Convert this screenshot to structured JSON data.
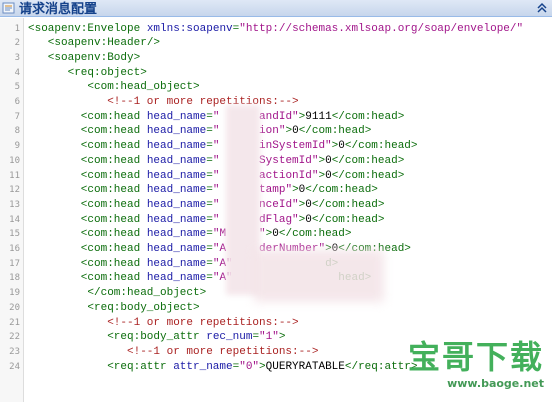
{
  "header": {
    "title": "请求消息配置"
  },
  "lines": [
    {
      "n": "1",
      "indent": 0,
      "parts": [
        [
          "tag",
          "<soapenv:Envelope "
        ],
        [
          "attr",
          "xmlns:soapenv"
        ],
        [
          "tag",
          "="
        ],
        [
          "val",
          "\"http://schemas.xmlsoap.org/soap/envelope/\""
        ]
      ]
    },
    {
      "n": "2",
      "indent": 3,
      "parts": [
        [
          "tag",
          "<soapenv:Header/>"
        ]
      ]
    },
    {
      "n": "3",
      "indent": 3,
      "parts": [
        [
          "tag",
          "<soapenv:Body>"
        ]
      ]
    },
    {
      "n": "4",
      "indent": 6,
      "parts": [
        [
          "tag",
          "<req:object>"
        ]
      ]
    },
    {
      "n": "5",
      "indent": 9,
      "parts": [
        [
          "tag",
          "<com:head_object>"
        ]
      ]
    },
    {
      "n": "6",
      "indent": 12,
      "parts": [
        [
          "com",
          "<!--1 or more repetitions:-->"
        ]
      ]
    },
    {
      "n": "7",
      "indent": 8,
      "parts": [
        [
          "tag",
          "<com:head "
        ],
        [
          "attr",
          "head_name"
        ],
        [
          "tag",
          "="
        ],
        [
          "val",
          "\"      andId\""
        ],
        [
          "tag",
          ">"
        ],
        [
          "text",
          "9111"
        ],
        [
          "tag",
          "</com:head>"
        ]
      ]
    },
    {
      "n": "8",
      "indent": 8,
      "parts": [
        [
          "tag",
          "<com:head "
        ],
        [
          "attr",
          "head_name"
        ],
        [
          "tag",
          "="
        ],
        [
          "val",
          "\"      ion\""
        ],
        [
          "tag",
          ">"
        ],
        [
          "text",
          "0"
        ],
        [
          "tag",
          "</com:head>"
        ]
      ]
    },
    {
      "n": "9",
      "indent": 8,
      "parts": [
        [
          "tag",
          "<com:head "
        ],
        [
          "attr",
          "head_name"
        ],
        [
          "tag",
          "="
        ],
        [
          "val",
          "\"      inSystemId\""
        ],
        [
          "tag",
          ">"
        ],
        [
          "text",
          "0"
        ],
        [
          "tag",
          "</com:head>"
        ]
      ]
    },
    {
      "n": "10",
      "indent": 8,
      "parts": [
        [
          "tag",
          "<com:head "
        ],
        [
          "attr",
          "head_name"
        ],
        [
          "tag",
          "="
        ],
        [
          "val",
          "\"      SystemId\""
        ],
        [
          "tag",
          ">"
        ],
        [
          "text",
          "0"
        ],
        [
          "tag",
          "</com:head>"
        ]
      ]
    },
    {
      "n": "11",
      "indent": 8,
      "parts": [
        [
          "tag",
          "<com:head "
        ],
        [
          "attr",
          "head_name"
        ],
        [
          "tag",
          "="
        ],
        [
          "val",
          "\"      actionId\""
        ],
        [
          "tag",
          ">"
        ],
        [
          "text",
          "0"
        ],
        [
          "tag",
          "</com:head>"
        ]
      ]
    },
    {
      "n": "12",
      "indent": 8,
      "parts": [
        [
          "tag",
          "<com:head "
        ],
        [
          "attr",
          "head_name"
        ],
        [
          "tag",
          "="
        ],
        [
          "val",
          "\"      tamp\""
        ],
        [
          "tag",
          ">"
        ],
        [
          "text",
          "0"
        ],
        [
          "tag",
          "</com:head>"
        ]
      ]
    },
    {
      "n": "13",
      "indent": 8,
      "parts": [
        [
          "tag",
          "<com:head "
        ],
        [
          "attr",
          "head_name"
        ],
        [
          "tag",
          "="
        ],
        [
          "val",
          "\"      nceId\""
        ],
        [
          "tag",
          ">"
        ],
        [
          "text",
          "0"
        ],
        [
          "tag",
          "</com:head>"
        ]
      ]
    },
    {
      "n": "14",
      "indent": 8,
      "parts": [
        [
          "tag",
          "<com:head "
        ],
        [
          "attr",
          "head_name"
        ],
        [
          "tag",
          "="
        ],
        [
          "val",
          "\"      dFlag\""
        ],
        [
          "tag",
          ">"
        ],
        [
          "text",
          "0"
        ],
        [
          "tag",
          "</com:head>"
        ]
      ]
    },
    {
      "n": "15",
      "indent": 8,
      "parts": [
        [
          "tag",
          "<com:head "
        ],
        [
          "attr",
          "head_name"
        ],
        [
          "tag",
          "="
        ],
        [
          "val",
          "\"M     \""
        ],
        [
          "tag",
          ">"
        ],
        [
          "text",
          "0"
        ],
        [
          "tag",
          "</com:head>"
        ]
      ]
    },
    {
      "n": "16",
      "indent": 8,
      "parts": [
        [
          "tag",
          "<com:head "
        ],
        [
          "attr",
          "head_name"
        ],
        [
          "tag",
          "="
        ],
        [
          "val",
          "\"A     derNumber\""
        ],
        [
          "tag",
          ">"
        ],
        [
          "text",
          "0"
        ],
        [
          "tag",
          "</com:head>"
        ]
      ]
    },
    {
      "n": "17",
      "indent": 8,
      "parts": [
        [
          "tag",
          "<com:head "
        ],
        [
          "attr",
          "head_name"
        ],
        [
          "tag",
          "="
        ],
        [
          "val",
          "\"A\""
        ],
        [
          "tag",
          "              d>"
        ]
      ]
    },
    {
      "n": "18",
      "indent": 8,
      "parts": [
        [
          "tag",
          "<com:head "
        ],
        [
          "attr",
          "head_name"
        ],
        [
          "tag",
          "="
        ],
        [
          "val",
          "\"A\""
        ],
        [
          "tag",
          "                head>"
        ]
      ]
    },
    {
      "n": "19",
      "indent": 9,
      "parts": [
        [
          "tag",
          "</com:head_object>"
        ]
      ]
    },
    {
      "n": "20",
      "indent": 9,
      "parts": [
        [
          "tag",
          "<req:body_object>"
        ]
      ]
    },
    {
      "n": "21",
      "indent": 12,
      "parts": [
        [
          "com",
          "<!--1 or more repetitions:-->"
        ]
      ]
    },
    {
      "n": "22",
      "indent": 12,
      "parts": [
        [
          "tag",
          "<req:body_attr "
        ],
        [
          "attr",
          "rec_num"
        ],
        [
          "tag",
          "="
        ],
        [
          "val",
          "\"1\""
        ],
        [
          "tag",
          ">"
        ]
      ]
    },
    {
      "n": "23",
      "indent": 15,
      "parts": [
        [
          "com",
          "<!--1 or more repetitions:-->"
        ]
      ]
    },
    {
      "n": "24",
      "indent": 12,
      "parts": [
        [
          "tag",
          "<req:attr "
        ],
        [
          "attr",
          "attr_name"
        ],
        [
          "tag",
          "="
        ],
        [
          "val",
          "\"0\""
        ],
        [
          "tag",
          ">"
        ],
        [
          "text",
          "QUERYRATABLE"
        ],
        [
          "tag",
          "</req:attr>"
        ]
      ]
    }
  ],
  "watermark": {
    "main": "宝哥下载",
    "url": "www.baoge.net"
  },
  "colors": {
    "header_bg": "#dfe8f6",
    "tag": "#0b6d0b",
    "attr": "#1a1aa6",
    "value": "#a1158a",
    "comment": "#aa2222"
  }
}
